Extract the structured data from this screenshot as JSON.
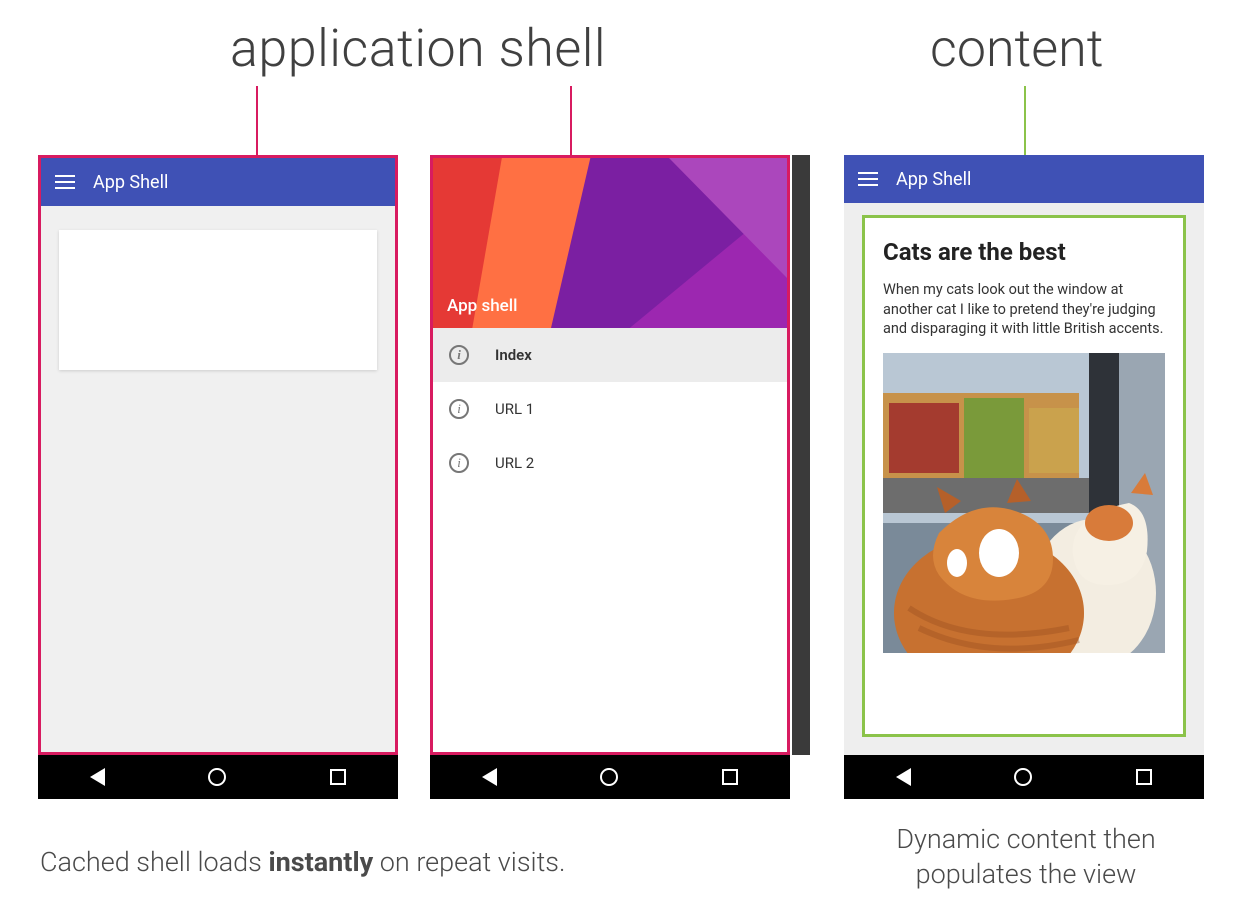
{
  "labels": {
    "shell": "application shell",
    "content": "content"
  },
  "colors": {
    "highlight_pink": "#d81b60",
    "highlight_green": "#8bc34a",
    "appbar": "#3f51b5"
  },
  "phone1": {
    "appbar_title": "App Shell"
  },
  "phone2": {
    "drawer_header_title": "App shell",
    "items": [
      {
        "icon": "info-icon",
        "label": "Index",
        "active": true
      },
      {
        "icon": "info-icon",
        "label": "URL 1",
        "active": false
      },
      {
        "icon": "info-icon",
        "label": "URL 2",
        "active": false
      }
    ]
  },
  "phone3": {
    "appbar_title": "App Shell",
    "article_title": "Cats are the best",
    "article_body": "When my cats look out the window at another cat I like to pretend they're judging and disparaging it with little British accents."
  },
  "captions": {
    "left_pre": "Cached shell loads ",
    "left_bold": "instantly",
    "left_post": " on repeat visits.",
    "right": "Dynamic content then populates the view"
  }
}
